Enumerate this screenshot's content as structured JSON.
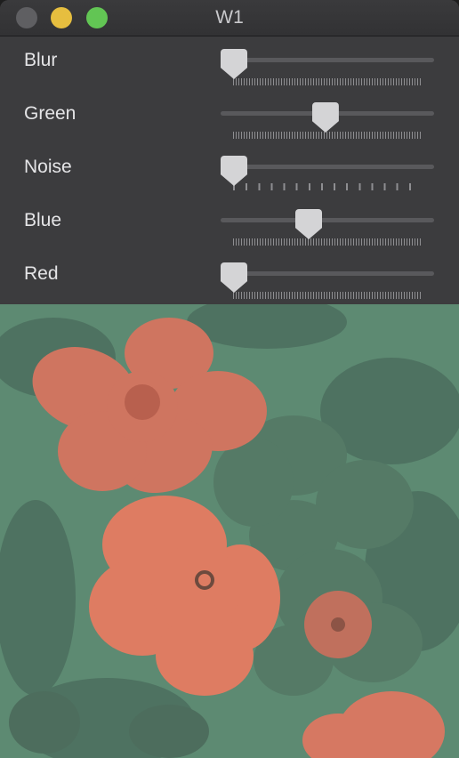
{
  "window": {
    "title": "W1",
    "traffic_lights": [
      {
        "name": "close",
        "color": "#5f5f62"
      },
      {
        "name": "minimize",
        "color": "#e6be3f"
      },
      {
        "name": "zoom",
        "color": "#62c554"
      }
    ]
  },
  "sliders": [
    {
      "label": "Blur",
      "value": 0.0,
      "ticks": "dense"
    },
    {
      "label": "Green",
      "value": 0.49,
      "ticks": "dense"
    },
    {
      "label": "Noise",
      "value": 0.0,
      "ticks": "sparse"
    },
    {
      "label": "Blue",
      "value": 0.4,
      "ticks": "dense"
    },
    {
      "label": "Red",
      "value": 0.0,
      "ticks": "dense"
    }
  ],
  "preview": {
    "description_icon": "image-preview",
    "colors": {
      "background": "#5d8a72",
      "petal": "#dc7a62",
      "dark_petal": "#4f6f5f"
    }
  }
}
